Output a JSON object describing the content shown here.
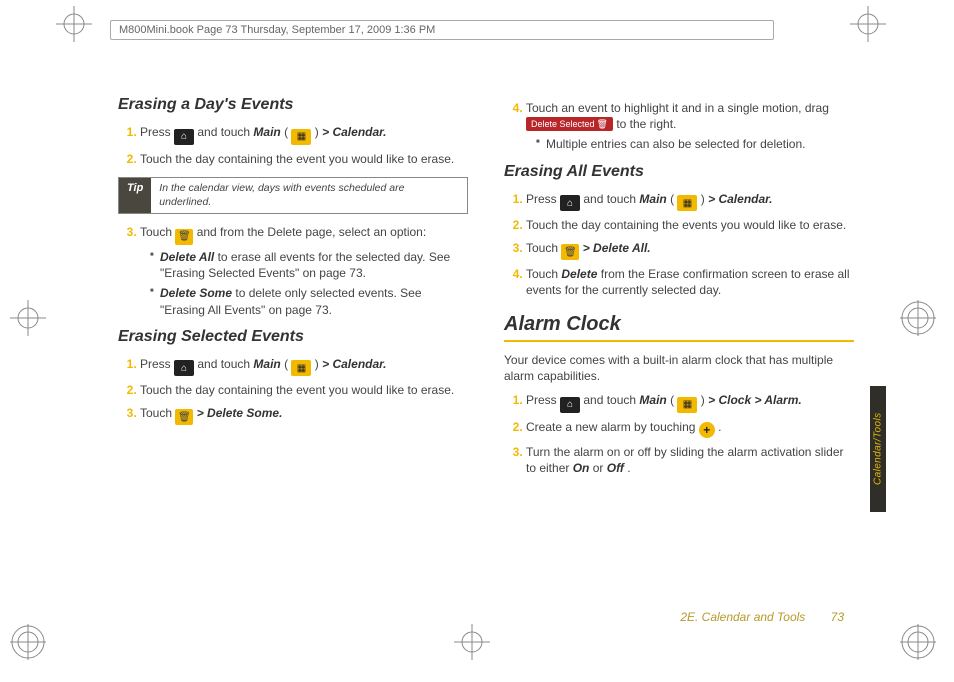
{
  "header": {
    "docinfo": "M800Mini.book  Page 73  Thursday, September 17, 2009  1:36 PM"
  },
  "left": {
    "h_erase_day": "Erasing a Day's Events",
    "s1_a": "Press ",
    "s1_b": " and touch ",
    "main": "Main",
    "gt_calendar": " > Calendar.",
    "s2": "Touch the day containing the event you would like to erase.",
    "tip_label": "Tip",
    "tip_body": "In the calendar view, days with events scheduled are underlined.",
    "s3_a": "Touch ",
    "s3_b": " and from the Delete page, select an option:",
    "del_all": "Delete All",
    "del_all_txt": " to erase all events for the selected day. See \"Erasing Selected Events\" on page 73.",
    "del_some": "Delete Some",
    "del_some_txt": " to delete only selected events. See \"Erasing All Events\" on page 73.",
    "h_erase_sel": "Erasing Selected Events",
    "sel_s3_a": "Touch ",
    "sel_s3_b": " > Delete Some."
  },
  "right": {
    "s4_a": "Touch an event to highlight it and in a single motion, drag ",
    "s4_b": " to the right.",
    "badge": "Delete Selected",
    "multi": "Multiple entries can also be selected for deletion.",
    "h_erase_all": "Erasing All Events",
    "all_s2": "Touch the day containing the events you would like to erase.",
    "all_s3_a": "Touch ",
    "all_s3_b": " > Delete All.",
    "all_s4_a": "Touch ",
    "delete_word": "Delete",
    "all_s4_b": " from the Erase confirmation screen to erase all events for the currently selected day.",
    "h_alarm": "Alarm Clock",
    "alarm_intro": "Your device comes with a built-in alarm clock that has multiple alarm capabilities.",
    "a1_b": " and touch ",
    "a1_tail": " > Clock > Alarm.",
    "a2_a": "Create a new alarm by touching ",
    "a2_b": ".",
    "a3_a": "Turn the alarm on or off by sliding the alarm activation slider to either ",
    "on": "On",
    "or": " or ",
    "off": "Off",
    "a3_b": "."
  },
  "footer": {
    "section": "2E. Calendar and Tools",
    "page": "73"
  },
  "sidetab": "Calendar/Tools"
}
